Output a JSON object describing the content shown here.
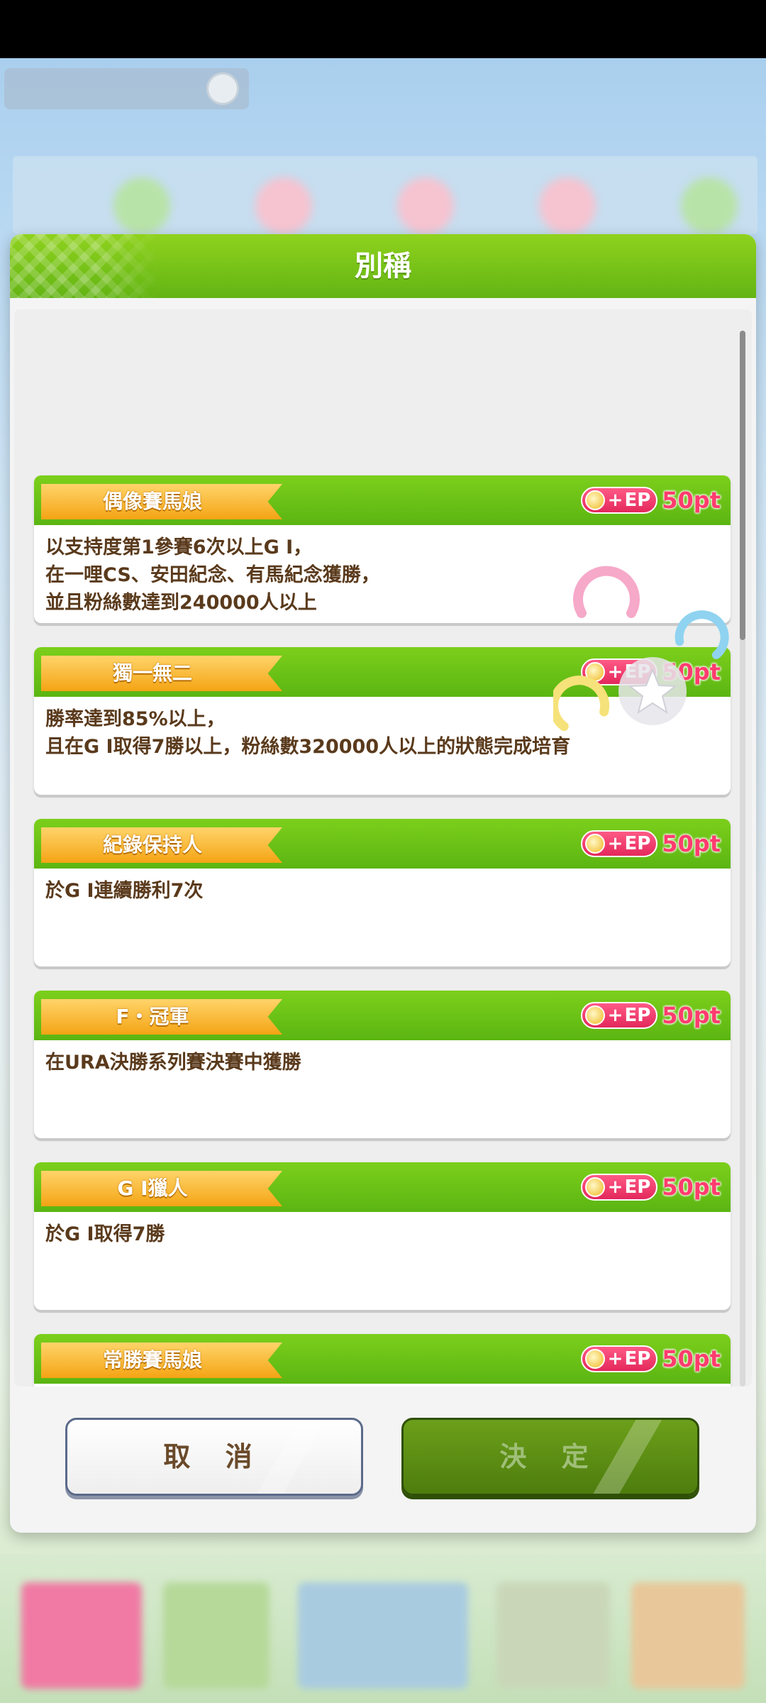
{
  "dialog": {
    "title": "別稱",
    "cancel_label": "取 消",
    "confirm_label": "決 定"
  },
  "colors": {
    "header_green": "#63b414",
    "ribbon_orange": "#f4a414",
    "ep_pink": "#e3285c",
    "text_brown": "#5a3a1c"
  },
  "nicknames": [
    {
      "name": "偶像賽馬娘",
      "reward_badge": "EP",
      "reward_points": "50pt",
      "lines": [
        "以支持度第1參賽6次以上G Ⅰ，",
        "在一哩CS、安田紀念、有馬紀念獲勝，",
        "並且粉絲數達到240000人以上"
      ]
    },
    {
      "name": "獨一無二",
      "reward_badge": "EP",
      "reward_points": "50pt",
      "lines": [
        "勝率達到85%以上，",
        "且在G Ⅰ取得7勝以上，粉絲數320000人以上的狀態完成培育"
      ]
    },
    {
      "name": "紀錄保持人",
      "reward_badge": "EP",
      "reward_points": "50pt",
      "lines": [
        "於G Ⅰ連續勝利7次"
      ]
    },
    {
      "name": "F・冠軍",
      "reward_badge": "EP",
      "reward_points": "50pt",
      "lines": [
        "在URA決勝系列賽決賽中獲勝"
      ]
    },
    {
      "name": "G Ⅰ獵人",
      "reward_badge": "EP",
      "reward_points": "50pt",
      "lines": [
        "於G Ⅰ取得7勝"
      ]
    },
    {
      "name": "常勝賽馬娘",
      "reward_badge": "EP",
      "reward_points": "50pt",
      "lines": []
    }
  ]
}
